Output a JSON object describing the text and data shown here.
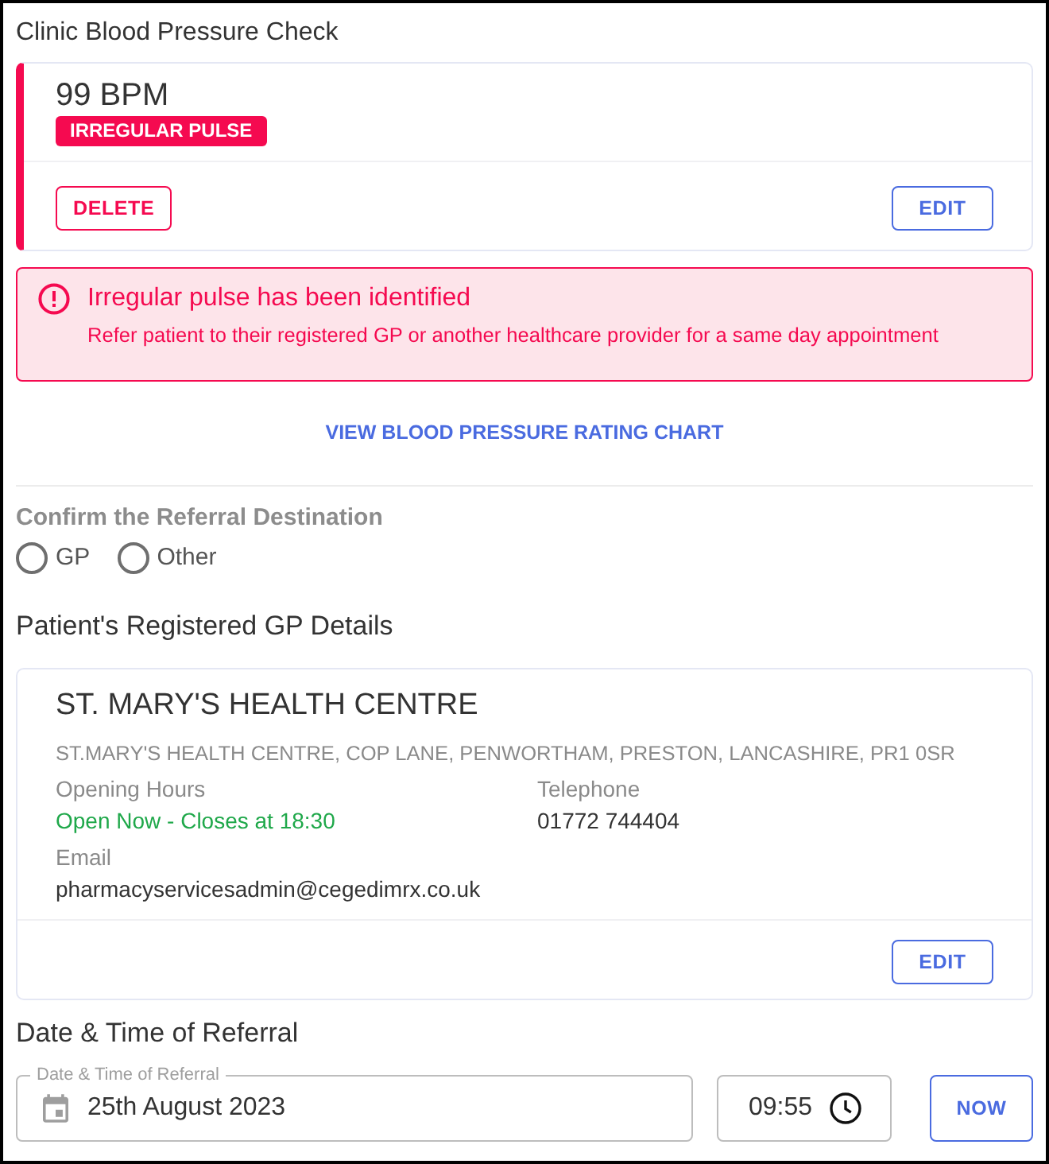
{
  "section_title": "Clinic Blood Pressure Check",
  "reading_card": {
    "value": "99 BPM",
    "badge": "IRREGULAR PULSE",
    "delete_button": "DELETE",
    "edit_button": "EDIT"
  },
  "alert": {
    "kind": "error",
    "title": "Irregular pulse has been identified",
    "message": "Refer patient to their registered GP or another healthcare provider for a same day appointment"
  },
  "chart_link": "VIEW BLOOD PRESSURE RATING CHART",
  "referral_destination": {
    "label": "Confirm the Referral Destination",
    "options": [
      {
        "label": "GP",
        "selected": false
      },
      {
        "label": "Other",
        "selected": false
      }
    ]
  },
  "gp_details": {
    "heading": "Patient's Registered GP Details",
    "name": "ST. MARY'S HEALTH CENTRE",
    "address": "ST.MARY'S HEALTH CENTRE, COP LANE, PENWORTHAM, PRESTON, LANCASHIRE, PR1 0SR",
    "fields": [
      {
        "label": "Opening Hours",
        "value": "Open Now - Closes at 18:30",
        "kind": "status"
      },
      {
        "label": "Telephone",
        "value": "01772 744404",
        "kind": "text"
      },
      {
        "label": "Email",
        "value": "pharmacyservicesadmin@cegedimrx.co.uk",
        "kind": "text"
      }
    ],
    "edit_button": "EDIT"
  },
  "referral_time": {
    "heading": "Date & Time of Referral",
    "date_field": {
      "label": "Date & Time of Referral",
      "value": "25th August 2023"
    },
    "time_field": {
      "value": "09:55"
    },
    "now_button": "NOW"
  }
}
